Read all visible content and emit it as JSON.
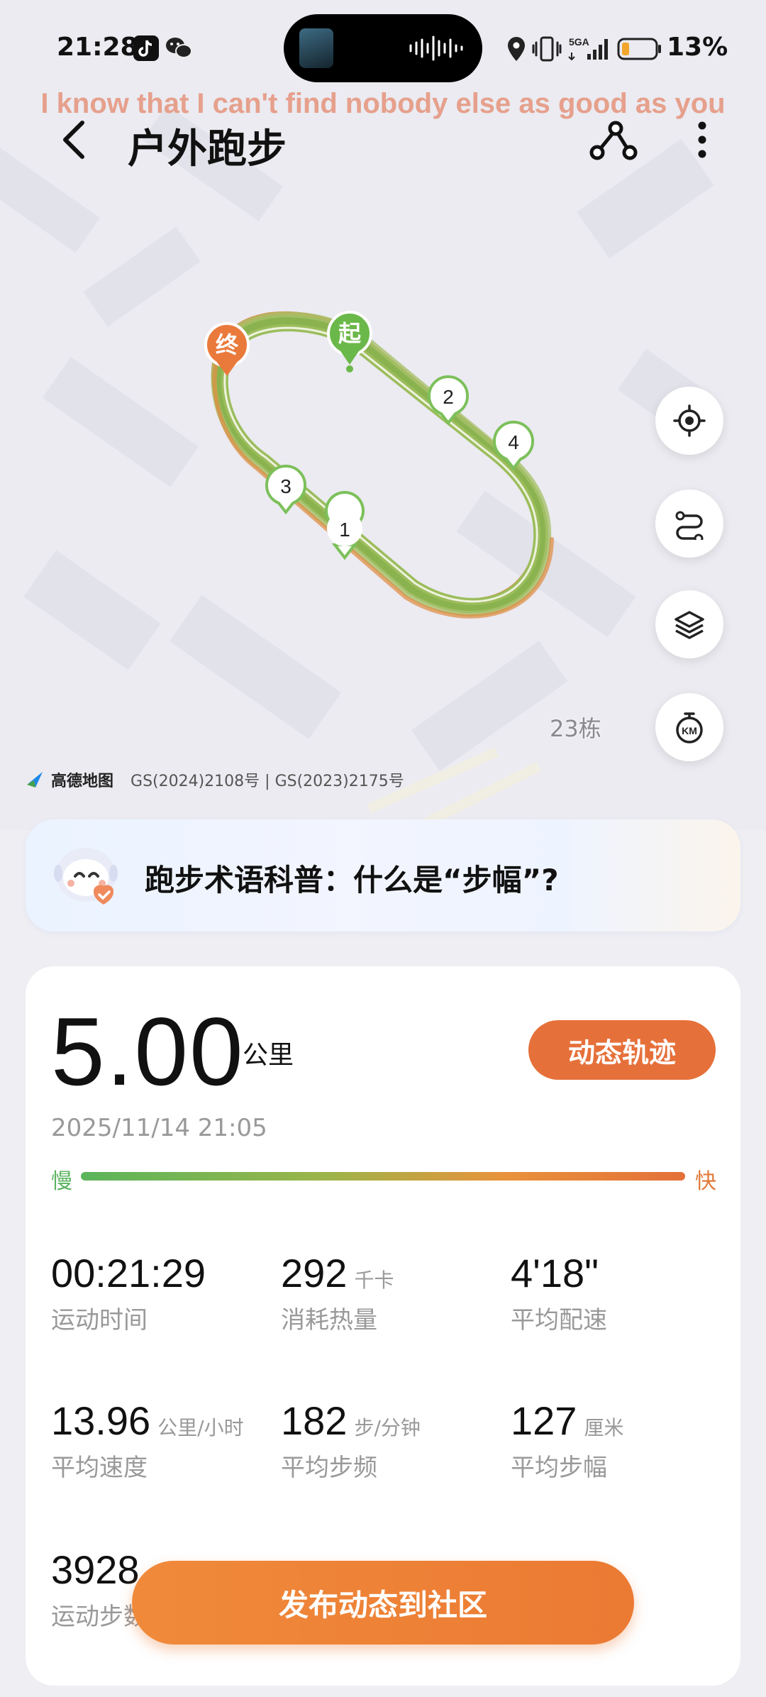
{
  "status_bar": {
    "time": "21:28",
    "network": "5GA",
    "battery": "13%"
  },
  "lyric": "I know that I can't find nobody else as good as you",
  "header": {
    "title": "户外跑步"
  },
  "map": {
    "start_marker": "起",
    "end_marker": "终",
    "km_markers": [
      "1",
      "2",
      "3",
      "4"
    ],
    "building_label": "23栋",
    "provider": "高德地图",
    "approval": "GS(2024)2108号 | GS(2023)2175号",
    "controls": [
      "locate-icon",
      "route-icon",
      "layers-icon",
      "km-icon"
    ]
  },
  "tip": {
    "text": "跑步术语科普：什么是“步幅”?"
  },
  "summary": {
    "distance": "5.00",
    "distance_unit": "公里",
    "dynamic_button": "动态轨迹",
    "datetime": "2025/11/14 21:05",
    "pace_slow": "慢",
    "pace_fast": "快"
  },
  "stats": [
    {
      "value": "00:21:29",
      "unit": "",
      "label": "运动时间"
    },
    {
      "value": "292",
      "unit": "千卡",
      "label": "消耗热量"
    },
    {
      "value": "4'18\"",
      "unit": "",
      "label": "平均配速"
    },
    {
      "value": "13.96",
      "unit": "公里/小时",
      "label": "平均速度"
    },
    {
      "value": "182",
      "unit": "步/分钟",
      "label": "平均步频"
    },
    {
      "value": "127",
      "unit": "厘米",
      "label": "平均步幅"
    },
    {
      "value": "3928",
      "unit": "",
      "label": "运动步数"
    }
  ],
  "publish_button": "发布动态到社区",
  "colors": {
    "accent": "#e6703a",
    "track_green": "#8ab34f",
    "track_orange": "#e08a3e",
    "start_green": "#6bb84a"
  }
}
